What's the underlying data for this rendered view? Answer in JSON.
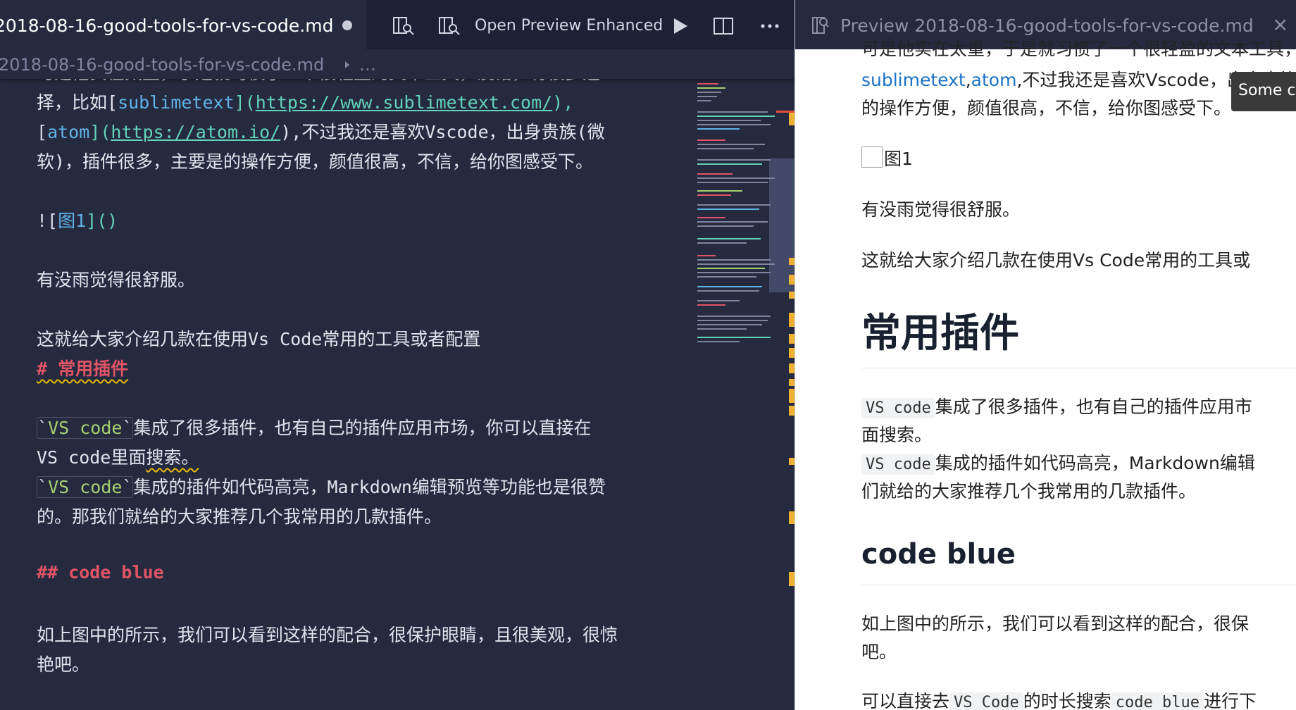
{
  "editor": {
    "tab": {
      "title": "2018-08-16-good-tools-for-vs-code.md"
    },
    "toolbar": {
      "preview_label": "Open Preview Enhanced"
    },
    "breadcrumb": {
      "file": "2018-08-16-good-tools-for-vs-code.md",
      "more": "…"
    },
    "lines": {
      "l0": "可是他实在太重，于是就习惯了一个很轻盈的文本工具，没错，有很多选",
      "l1_pre": "择，比如[",
      "l1_link": "sublimetext",
      "l1_mid": "](",
      "l1_url": "https://www.sublimetext.com/",
      "l1_end": "),",
      "l2_lb": "[",
      "l2_link": "atom",
      "l2_mid": "](",
      "l2_url": "https://atom.io/",
      "l2_end": "),不过我还是喜欢Vscode，出身贵族(微",
      "l3": "软)，插件很多，主要是的操作方便，颜值很高，不信，给你图感受下。",
      "l4_ex": "![",
      "l4_alt": "图1",
      "l4_end": "]()",
      "l5": "有没雨觉得很舒服。",
      "l6": "这就给大家介绍几款在使用Vs Code常用的工具或者配置",
      "l7": "# 常用插件",
      "l8_bt1": "`",
      "l8_code": "VS code",
      "l8_bt2": "`",
      "l8_text": "集成了很多插件，也有自己的插件应用市场，你可以直接在",
      "l9_pre": "VS code里面",
      "l9_sq": "搜索。",
      "l10_bt1": "`",
      "l10_code": "VS code",
      "l10_bt2": "`",
      "l10_text": "集成的插件如代码高亮，Markdown编辑预览等功能也是很赞",
      "l11": "的。那我们就给的大家推荐几个我常用的几款插件。",
      "l12": "## code blue",
      "l13": "如上图中的所示，我们可以看到这样的配合，很保护眼睛，且很美观，很惊",
      "l14": "艳吧。"
    }
  },
  "preview": {
    "tab": {
      "title": "Preview 2018-08-16-good-tools-for-vs-code.md",
      "close": "×"
    },
    "p0": "可是他实在太重，于是就习惯了一个很轻盈的文本工具，没错",
    "p1_link1": "sublimetext",
    "p1_comma": ",",
    "p1_link2": "atom",
    "p1_text": ",不过我还是喜欢Vscode，出身贵族",
    "p2": "的操作方便，颜值很高，不信，给你图感受下。",
    "img_alt": "图1",
    "p3": "有没雨觉得很舒服。",
    "p4": "这就给大家介绍几款在使用Vs Code常用的工具或",
    "h1": "常用插件",
    "p5_code": "VS code",
    "p5_text": "集成了很多插件，也有自己的插件应用市",
    "p6": "面搜索。",
    "p7_code": "VS code",
    "p7_text": "集成的插件如代码高亮，Markdown编辑",
    "p8": "们就给的大家推荐几个我常用的几款插件。",
    "h2": "code blue",
    "p9": "如上图中的所示，我们可以看到这样的配合，很保",
    "p10": "吧。",
    "p11_pre": "可以直接去",
    "p11_code1": "VS Code",
    "p11_mid": "的时长搜索",
    "p11_code2": "code blue",
    "p11_end": "进行下"
  },
  "tooltip": {
    "text": "Some c"
  },
  "colors": {
    "editor_bg": "#262a3f",
    "heading": "#e05466",
    "link": "#5fb3e8",
    "url": "#62d3b7",
    "inline_code": "#a6d171",
    "preview_link": "#1a73c8"
  }
}
